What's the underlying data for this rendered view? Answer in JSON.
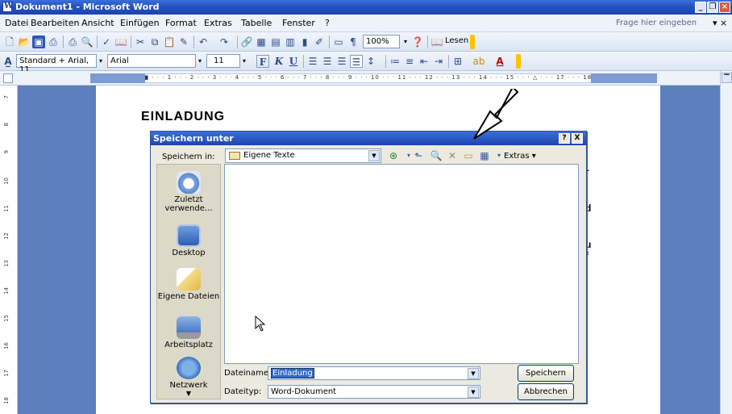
{
  "window": {
    "title": "Dokument1 - Microsoft Word"
  },
  "menubar": {
    "items": [
      "Datei",
      "Bearbeiten",
      "Ansicht",
      "Einfügen",
      "Format",
      "Extras",
      "Tabelle",
      "Fenster",
      "?"
    ],
    "help_placeholder": "Frage hier eingeben"
  },
  "toolbar": {
    "zoom": "100%",
    "reading_label": "Lesen"
  },
  "format_bar": {
    "style": "Standard + Arial, 11",
    "font": "Arial",
    "size": "11"
  },
  "ruler": {
    "marks": "· 2 · · · 1 · · · ■ · · · 1 · · · 2 · · · 3 · · · 4 · · · 5 · · · 6 · · · 7 · · · 8 · · · 9 · · · 10 · · · 11 · · · 12 · · · 13 · · · 14 · · · 15 · · · △ · · · 17 · · · 18 ·"
  },
  "vruler": {
    "marks": [
      "7",
      "8",
      "9",
      "10",
      "11",
      "12",
      "13",
      "14",
      "15",
      "16",
      "17",
      "18"
    ]
  },
  "document": {
    "heading": "EINLADUNG",
    "fragments": [
      "r",
      "d",
      "u",
      "f"
    ]
  },
  "dialog": {
    "title": "Speichern unter",
    "help_btn": "?",
    "close_btn": "X",
    "lookin_label": "Speichern in:",
    "lookin_value": "Eigene Texte",
    "extras_label": "Extras",
    "places": [
      "Zuletzt verwende...",
      "Desktop",
      "Eigene Dateien",
      "Arbeitsplatz",
      "Netzwerk"
    ],
    "filename_label": "Dateiname:",
    "filename_value": "Einladung",
    "filetype_label": "Dateityp:",
    "filetype_value": "Word-Dokument",
    "save_label": "Speichern",
    "cancel_label": "Abbrechen"
  },
  "colors": {
    "titlebar": "#2552c4",
    "workspace": "#5d7fbd",
    "dialog_bg": "#eceae0",
    "selection": "#316ac5"
  }
}
